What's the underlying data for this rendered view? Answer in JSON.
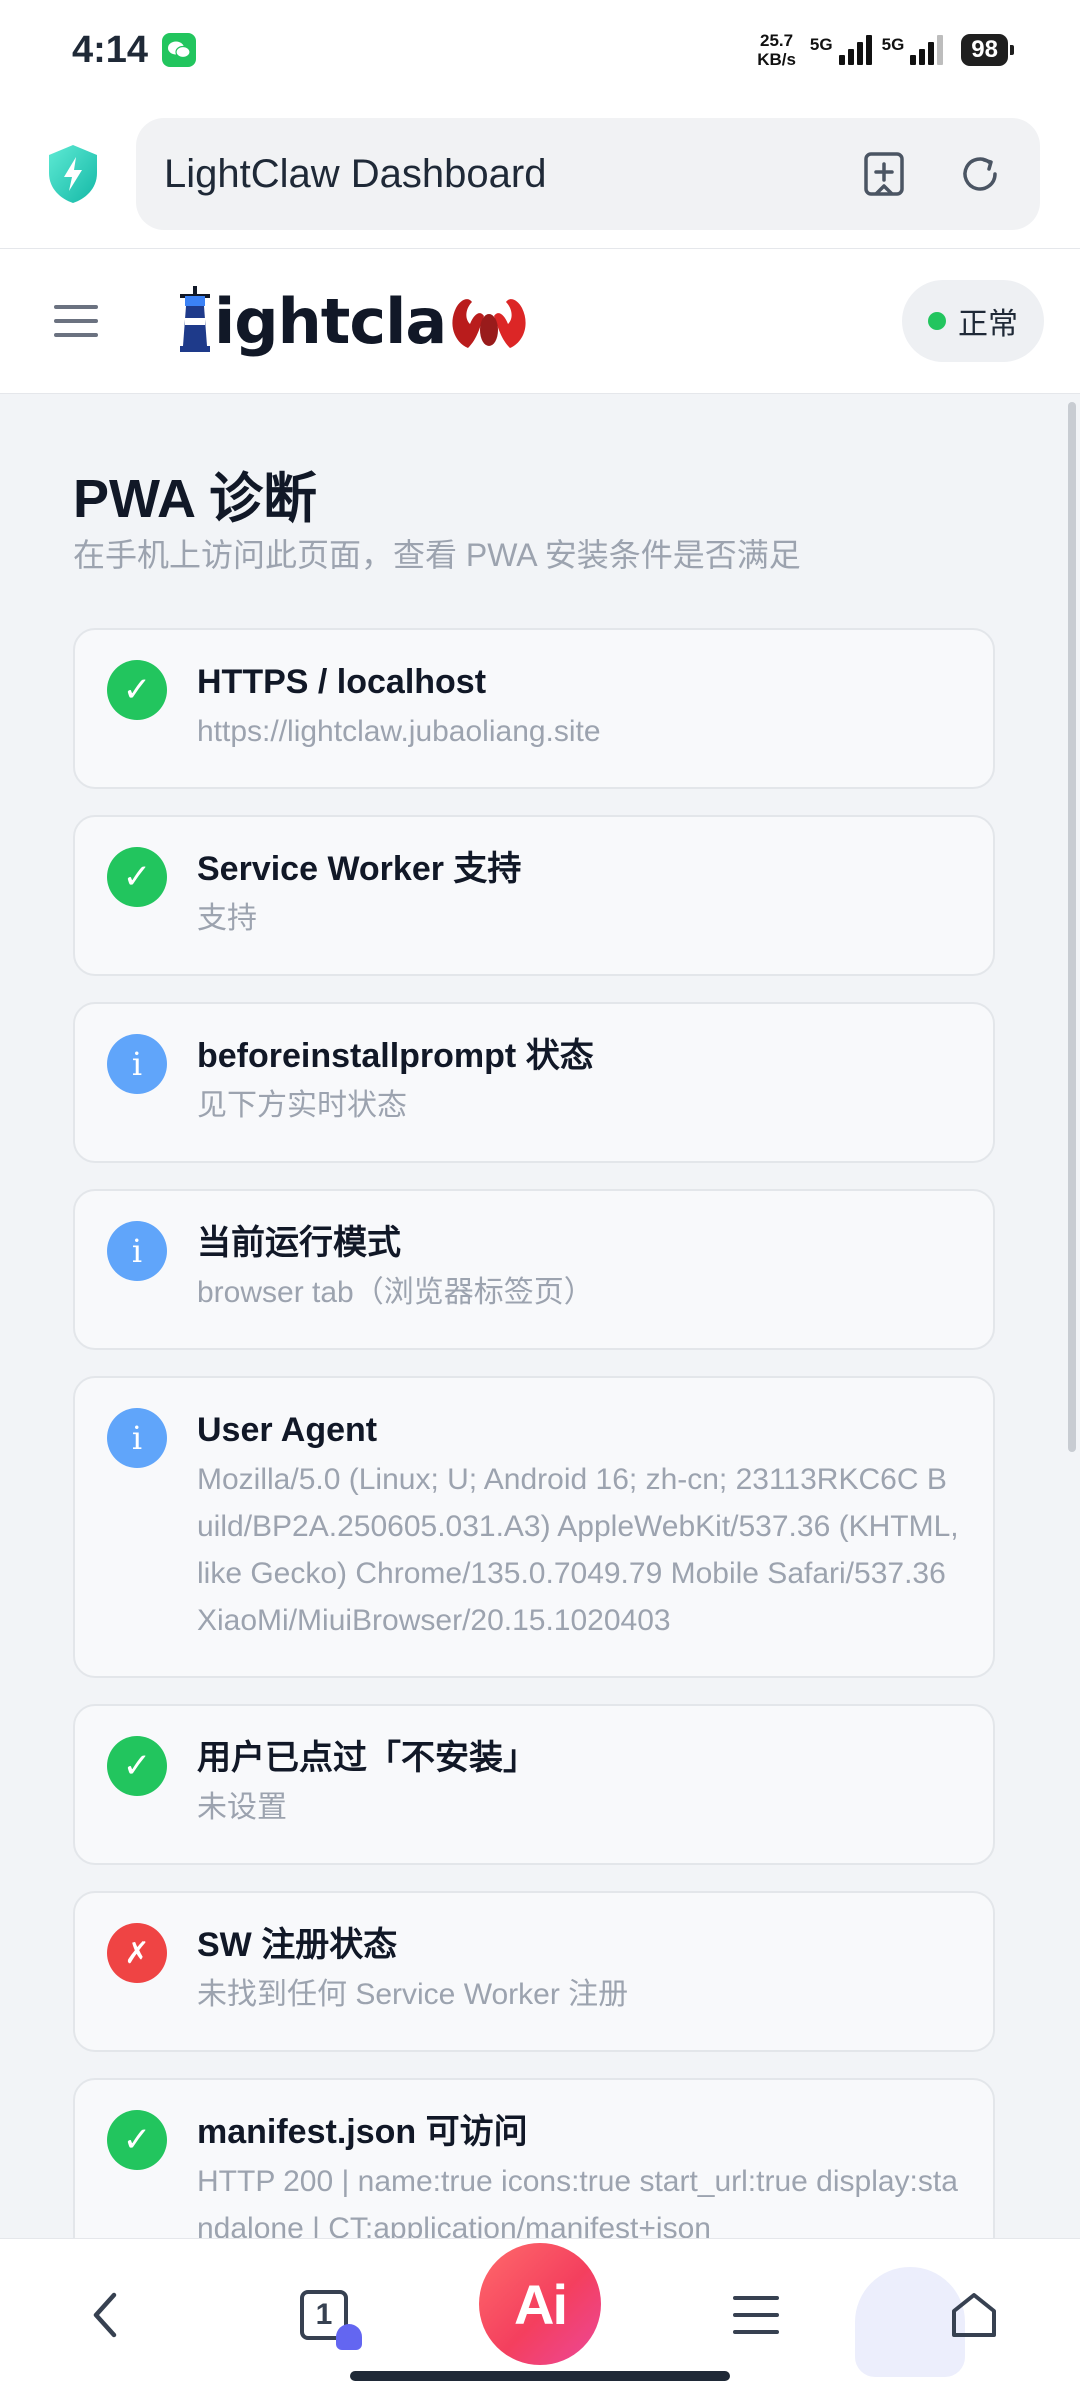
{
  "status_bar": {
    "time": "4:14",
    "net_speed_value": "25.7",
    "net_speed_unit": "KB/s",
    "sim1_label": "5G",
    "sim2_label": "5G",
    "battery": "98",
    "icons": [
      "wechat-icon",
      "signal-icon",
      "battery-icon"
    ]
  },
  "browser": {
    "address_title": "LightClaw Dashboard",
    "icons": [
      "shield-bolt-icon",
      "add-bookmark-icon",
      "refresh-icon"
    ]
  },
  "header": {
    "logo_text": "ightcla",
    "status_label": "正常",
    "accent": "#22c55e"
  },
  "main": {
    "title": "PWA 诊断",
    "subtitle": "在手机上访问此页面，查看 PWA 安装条件是否满足",
    "checks": [
      {
        "status": "ok",
        "icon": "✓",
        "title": "HTTPS / localhost",
        "detail": "https://lightclaw.jubaoliang.site"
      },
      {
        "status": "ok",
        "icon": "✓",
        "title": "Service Worker 支持",
        "detail": "支持"
      },
      {
        "status": "info",
        "icon": "i",
        "title": "beforeinstallprompt 状态",
        "detail": "见下方实时状态"
      },
      {
        "status": "info",
        "icon": "i",
        "title": "当前运行模式",
        "detail": "browser tab（浏览器标签页）"
      },
      {
        "status": "info",
        "icon": "i",
        "title": "User Agent",
        "detail": "Mozilla/5.0 (Linux; U; Android 16; zh-cn; 23113RKC6C Build/BP2A.250605.031.A3) AppleWebKit/537.36 (KHTML, like Gecko) Chrome/135.0.7049.79 Mobile Safari/537.36 XiaoMi/MiuiBrowser/20.15.1020403"
      },
      {
        "status": "ok",
        "icon": "✓",
        "title": "用户已点过「不安装」",
        "detail": "未设置"
      },
      {
        "status": "err",
        "icon": "✗",
        "title": "SW 注册状态",
        "detail": "未找到任何 Service Worker 注册"
      },
      {
        "status": "ok",
        "icon": "✓",
        "title": "manifest.json 可访问",
        "detail": "HTTP 200 | name:true icons:true start_url:true display:standalone | CT:application/manifest+json"
      }
    ]
  },
  "bottom_nav": {
    "tab_count": "1",
    "ai_label": "Ai",
    "icons": [
      "back-icon",
      "tabs-icon",
      "ai-icon",
      "menu-icon",
      "home-icon"
    ]
  }
}
